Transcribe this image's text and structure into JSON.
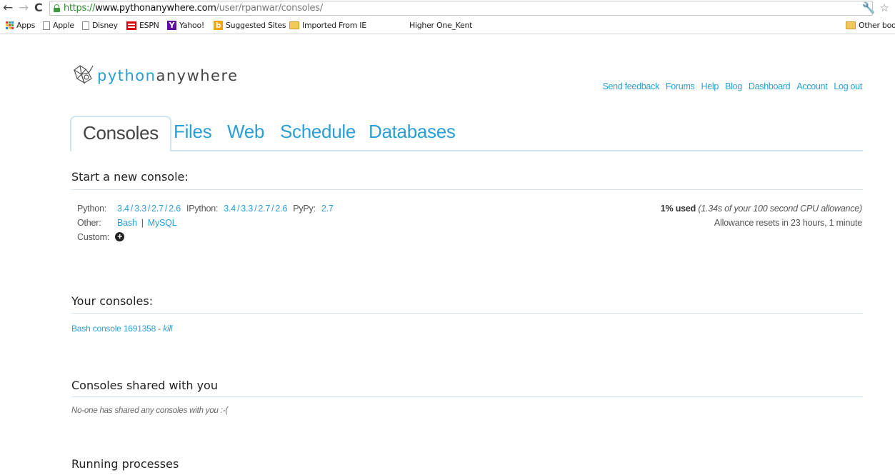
{
  "browser": {
    "url": {
      "scheme": "https://",
      "host": "www.pythonanywhere.com",
      "path": "/user/rpanwar/consoles/"
    },
    "bookmarks": [
      {
        "label": "Apps",
        "icon": "apps-grid-icon"
      },
      {
        "label": "Apple",
        "icon": "page-icon"
      },
      {
        "label": "Disney",
        "icon": "page-icon"
      },
      {
        "label": "ESPN",
        "icon": "espn-icon"
      },
      {
        "label": "Yahoo!",
        "icon": "yahoo-icon"
      },
      {
        "label": "Suggested Sites",
        "icon": "bing-icon"
      },
      {
        "label": "Imported From IE",
        "icon": "folder-icon"
      },
      {
        "label": "Higher One_Kent",
        "icon": "none"
      }
    ],
    "other_bookmarks": "Other boo"
  },
  "header": {
    "logo_text_a": "python",
    "logo_text_b": "anywhere",
    "links": [
      "Send feedback",
      "Forums",
      "Help",
      "Blog",
      "Dashboard",
      "Account",
      "Log out"
    ]
  },
  "tabs": [
    "Consoles",
    "Files",
    "Web",
    "Schedule",
    "Databases"
  ],
  "start_console": {
    "title": "Start a new console:",
    "python_label": "Python:",
    "python_versions": [
      "3.4",
      "3.3",
      "2.7",
      "2.6"
    ],
    "ipython_label": "IPython:",
    "ipython_versions": [
      "3.4",
      "3.3",
      "2.7",
      "2.6"
    ],
    "pypy_label": "PyPy:",
    "pypy_versions": [
      "2.7"
    ],
    "other_label": "Other:",
    "other_items": [
      "Bash",
      "MySQL"
    ],
    "custom_label": "Custom:"
  },
  "cpu": {
    "used": "1% used",
    "detail": "(1.34s of your 100 second CPU allowance)",
    "reset": "Allowance resets in 23 hours, 1 minute"
  },
  "your_consoles": {
    "title": "Your consoles:",
    "console_name": "Bash console 1691358",
    "dash": " - ",
    "kill": "kill"
  },
  "shared": {
    "title": "Consoles shared with you",
    "empty": "No-one has shared any consoles with you :-("
  },
  "processes": {
    "title": "Running processes"
  },
  "colors": {
    "link": "#2a9fd6",
    "rule": "#cfe6f2",
    "text": "#333333"
  }
}
